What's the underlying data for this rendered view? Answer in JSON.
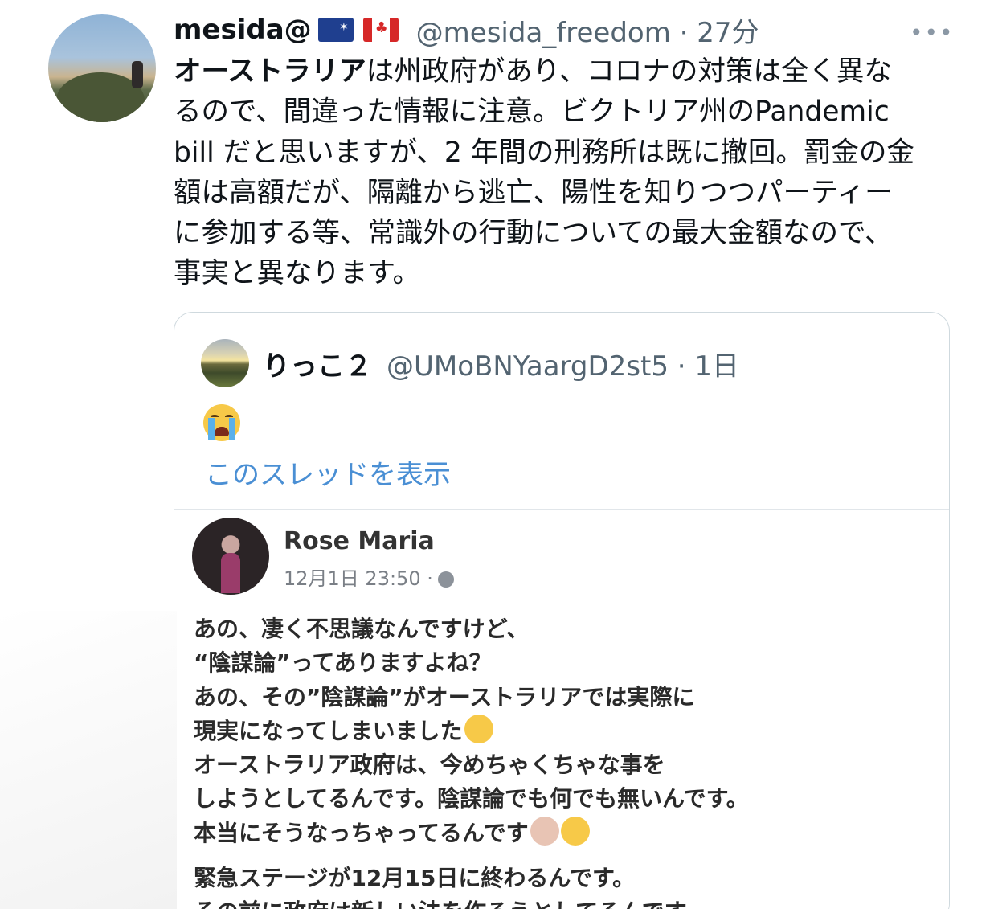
{
  "tweet": {
    "name": "mesida@",
    "flags": [
      "australia-flag",
      "canada-flag"
    ],
    "handle_time": "@mesida_freedom · 27分",
    "more": "•••",
    "text_lines": [
      {
        "bold": "オーストラリア",
        "rest": "は州政府があり、コロナの対策は全く異な"
      },
      {
        "bold": "",
        "rest": "るので、間違った情報に注意。ビクトリア州のPandemic"
      },
      {
        "bold": "",
        "rest": "bill だと思いますが、2 年間の刑務所は既に撤回。罰金の金"
      },
      {
        "bold": "",
        "rest": "額は高額だが、隔離から逃亡、陽性を知りつつパーティー"
      },
      {
        "bold": "",
        "rest": "に参加する等、常識外の行動についての最大金額なので、"
      },
      {
        "bold": "",
        "rest": "事実と異なります。"
      }
    ]
  },
  "quote": {
    "name": "りっこ２",
    "handle_time": "@UMoBNYaargD2st5 · 1日",
    "emoji": "loudly-crying-face",
    "thread_link": "このスレッドを表示",
    "embedded_post": {
      "name": "Rose Maria",
      "time": "12月1日 23:50 ·",
      "lines": [
        "あの、凄く不思議なんですけど、",
        "“陰謀論”ってありますよね？",
        "あの、その”陰謀論”がオーストラリアでは実際に",
        "現実になってしまいました",
        "オーストラリア政府は、今めちゃくちゃな事を",
        "しようとしてるんです。陰謀論でも何でも無いんです。",
        "本当にそうなっちゃってるんです",
        "緊急ステージが12月15日に終わるんです。",
        "その前に政府は新しい法を作ろうとしてるんです。"
      ]
    }
  }
}
